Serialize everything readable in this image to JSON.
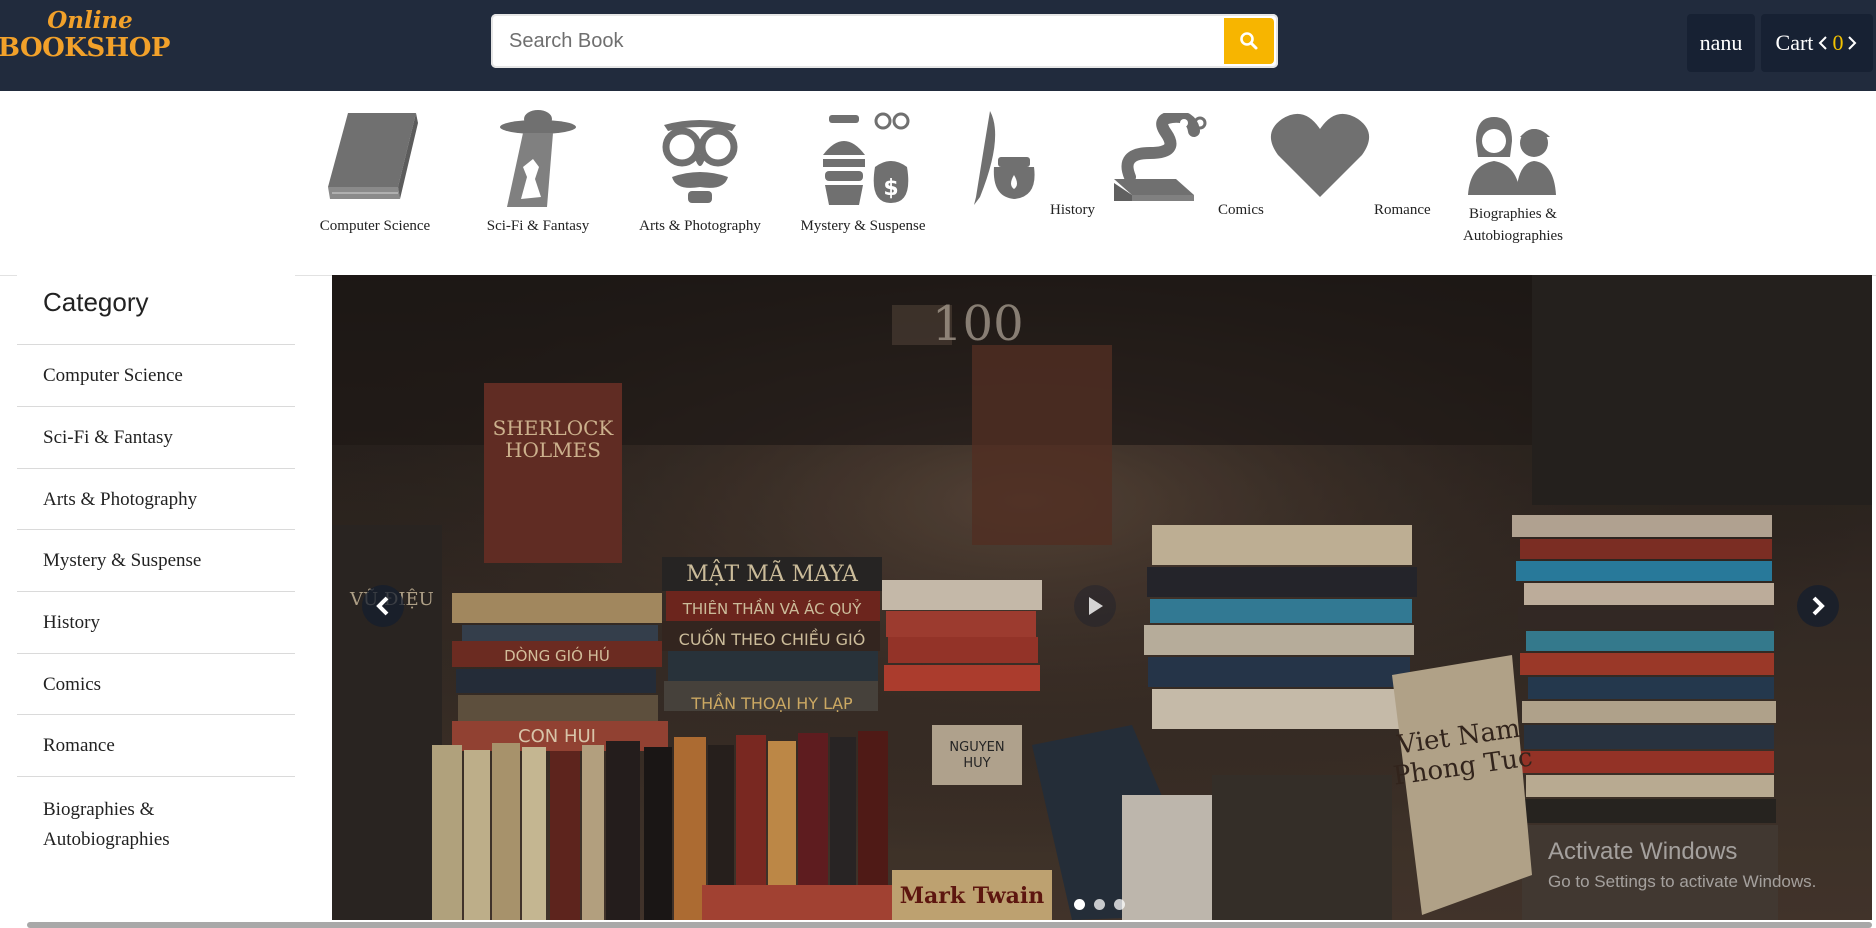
{
  "header": {
    "logo_line1": "Online",
    "logo_line2": "BOOKSHOP",
    "search_placeholder": "Search Book",
    "user_label": "nanu",
    "cart_label": "Cart",
    "cart_count": "0"
  },
  "categories": [
    {
      "label": "Computer Science",
      "icon": "book-icon"
    },
    {
      "label": "Sci-Fi & Fantasy",
      "icon": "ufo-icon"
    },
    {
      "label": "Arts & Photography",
      "icon": "disguise-glasses-icon"
    },
    {
      "label": "Mystery & Suspense",
      "icon": "thief-icon"
    },
    {
      "label": "History",
      "icon": "quill-ink-icon"
    },
    {
      "label": "Comics",
      "icon": "bookworm-icon"
    },
    {
      "label": "Romance",
      "icon": "heart-icon"
    },
    {
      "label": "Biographies & Autobiographies",
      "icon": "people-icon"
    }
  ],
  "sidebar": {
    "title": "Category",
    "items": [
      "Computer Science",
      "Sci-Fi & Fantasy",
      "Arts & Photography",
      "Mystery & Suspense",
      "History",
      "Comics",
      "Romance",
      "Biographies & Autobiographies"
    ]
  },
  "carousel": {
    "slide_count": 3,
    "active_slide": 1,
    "book_spine_texts": [
      "SHERLOCK HOLMES",
      "MẬT MÃ MAYA",
      "THIÊN THẦN VÀ ÁC QUỶ",
      "CUỐN THEO CHIỀU GIÓ",
      "THẦN THOẠI HY LẠP",
      "DÒNG GIÓ HÚ",
      "CON HUI",
      "NGUYEN HUY",
      "Viet Nam Phong Tuc",
      "Mark Twain"
    ]
  },
  "watermark": {
    "line1": "Activate Windows",
    "line2": "Go to Settings to activate Windows."
  },
  "colors": {
    "header_bg": "#212b3d",
    "accent": "#f7b500",
    "logo": "#f2a12a",
    "icon_gray": "#707070"
  }
}
